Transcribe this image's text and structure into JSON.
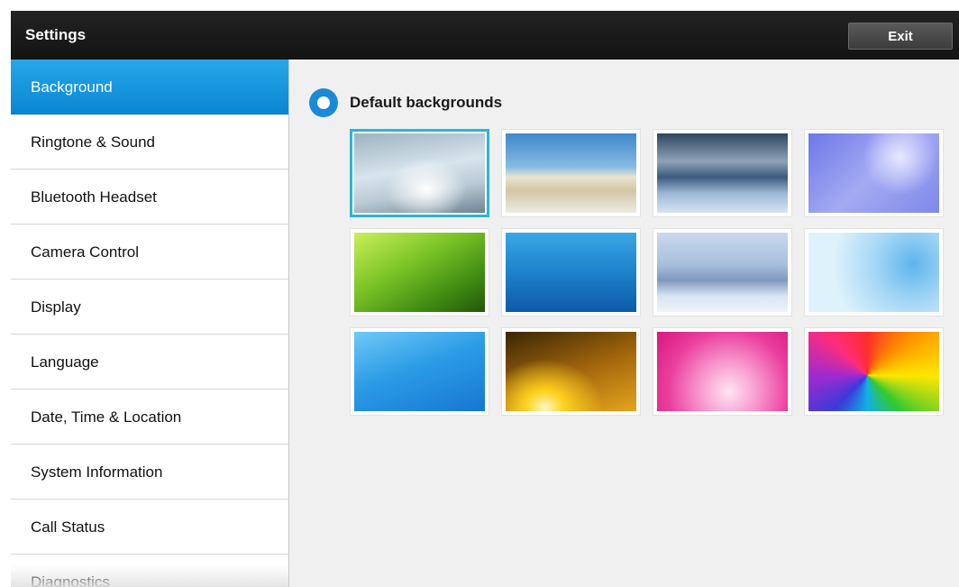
{
  "app": {
    "title": "Settings",
    "exit_label": "Exit"
  },
  "sidebar": {
    "items": [
      {
        "label": "Background",
        "active": true
      },
      {
        "label": "Ringtone & Sound"
      },
      {
        "label": "Bluetooth Headset"
      },
      {
        "label": "Camera Control"
      },
      {
        "label": "Display"
      },
      {
        "label": "Language"
      },
      {
        "label": "Date, Time & Location"
      },
      {
        "label": "System Information"
      },
      {
        "label": "Call Status"
      },
      {
        "label": "Diagnostics"
      }
    ]
  },
  "content": {
    "section_title": "Default backgrounds",
    "radio_selected": true,
    "accent_color": "#1a8ad8",
    "thumbnails": [
      {
        "name": "silver-swirl",
        "selected": true
      },
      {
        "name": "beach-dunes"
      },
      {
        "name": "stormy-sea"
      },
      {
        "name": "purple-dandelion"
      },
      {
        "name": "green-meadow"
      },
      {
        "name": "underwater-blue"
      },
      {
        "name": "frost-crystals"
      },
      {
        "name": "light-blue-rings"
      },
      {
        "name": "blue-waves"
      },
      {
        "name": "golden-light"
      },
      {
        "name": "pink-swirl"
      },
      {
        "name": "rainbow-burst"
      }
    ]
  }
}
